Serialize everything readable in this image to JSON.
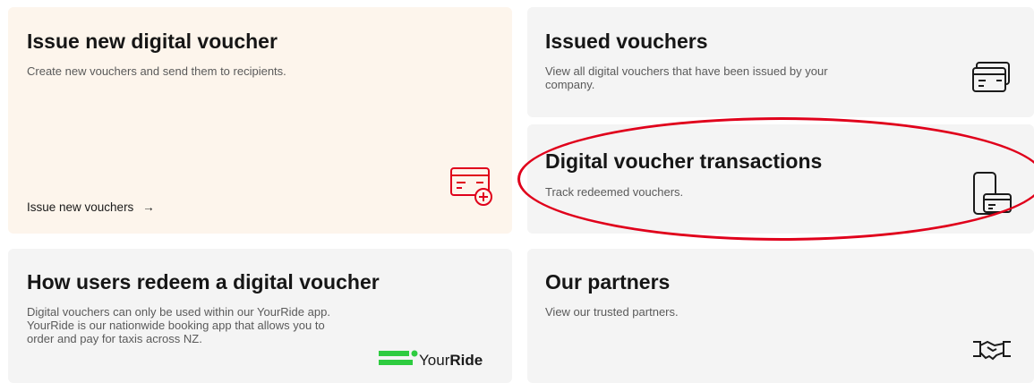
{
  "cards": {
    "issue": {
      "title": "Issue new digital voucher",
      "description": "Create new vouchers and send them to recipients.",
      "link": "Issue new vouchers",
      "link_arrow": "→",
      "icon": "voucher-add-icon"
    },
    "issued": {
      "title": "Issued vouchers",
      "description": "View all digital vouchers that have been issued by your company.",
      "icon": "vouchers-stack-icon"
    },
    "transactions": {
      "title": "Digital voucher transactions",
      "description": "Track redeemed vouchers.",
      "icon": "phone-voucher-icon"
    },
    "how": {
      "title": "How users redeem a digital voucher",
      "description": "Digital vouchers can only be used within our YourRide app. YourRide is our nationwide booking app that allows you to order and pay for taxis across NZ.",
      "logo_prefix": "Your",
      "logo_bold": "Ride"
    },
    "partners": {
      "title": "Our partners",
      "description": "View our trusted partners.",
      "icon": "handshake-icon"
    }
  },
  "colors": {
    "accent_red": "#e0001b",
    "yourride_green": "#2ecc40",
    "warm_card_bg": "#fdf5ec",
    "card_bg": "#f4f4f4"
  }
}
